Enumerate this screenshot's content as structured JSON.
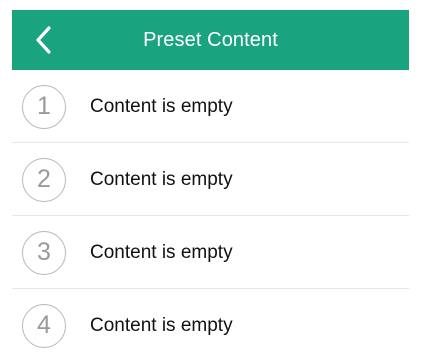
{
  "header": {
    "title": "Preset Content",
    "back_icon": "chevron-left-icon",
    "background": "#1aa37f"
  },
  "presets": [
    {
      "number": "1",
      "label": "Content is empty"
    },
    {
      "number": "2",
      "label": "Content is empty"
    },
    {
      "number": "3",
      "label": "Content is empty"
    },
    {
      "number": "4",
      "label": "Content is empty"
    }
  ]
}
